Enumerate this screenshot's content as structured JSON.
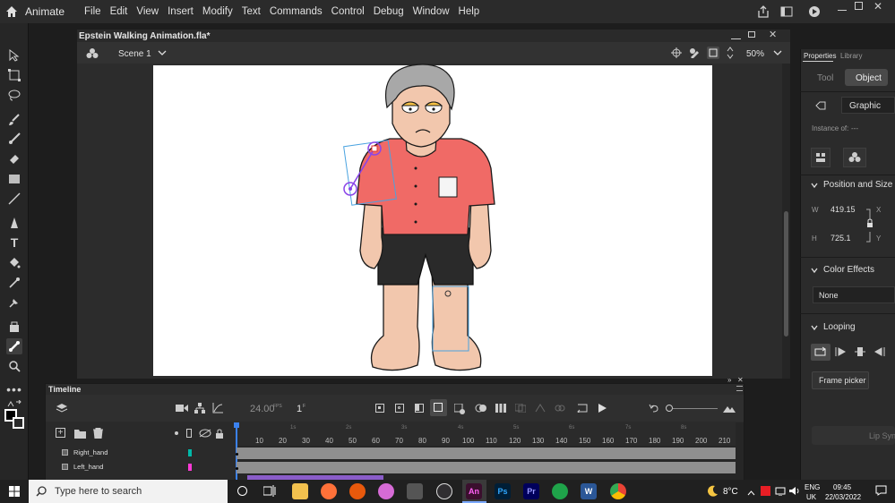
{
  "menubar": {
    "app_name": "Animate",
    "menus": [
      "File",
      "Edit",
      "View",
      "Insert",
      "Modify",
      "Text",
      "Commands",
      "Control",
      "Debug",
      "Window",
      "Help"
    ]
  },
  "document": {
    "title": "Epstein Walking Animation.fla*",
    "scene": "Scene 1",
    "zoom": "50%"
  },
  "properties": {
    "tabs": [
      "Properties",
      "Library"
    ],
    "subtabs": [
      "Tool",
      "Object"
    ],
    "symbol_type": "Graphic",
    "instance_of_label": "Instance of:",
    "instance_of_value": "---",
    "position_size_title": "Position and Size",
    "w_label": "W",
    "w_value": "419.15",
    "x_label": "X",
    "h_label": "H",
    "h_value": "725.1",
    "y_label": "Y",
    "color_effects_title": "Color Effects",
    "color_effects_value": "None",
    "looping_title": "Looping",
    "frame_picker": "Frame picker",
    "lip_sync": "Lip Sync"
  },
  "timeline": {
    "title": "Timeline",
    "fps": "24.00",
    "fps_unit": "FPS",
    "current_frame": "1",
    "frame_unit": "F",
    "ruler_numbers": [
      "10",
      "20",
      "30",
      "40",
      "50",
      "60",
      "70",
      "80",
      "90",
      "100",
      "110",
      "120",
      "130",
      "140",
      "150",
      "160",
      "170",
      "180",
      "190",
      "200",
      "210"
    ],
    "ruler_seconds": [
      "1s",
      "2s",
      "3s",
      "4s",
      "5s",
      "6s",
      "7s",
      "8s"
    ],
    "layers": [
      {
        "name": "Right_hand",
        "color": "#00b8a8"
      },
      {
        "name": "Left_hand",
        "color": "#ff3ad6"
      }
    ]
  },
  "taskbar": {
    "search_placeholder": "Type here to search",
    "weather": "8°C",
    "language": "ENG",
    "region": "UK",
    "time": "09:45",
    "date": "22/03/2022",
    "apps": [
      "An",
      "Ps",
      "Pr"
    ]
  }
}
